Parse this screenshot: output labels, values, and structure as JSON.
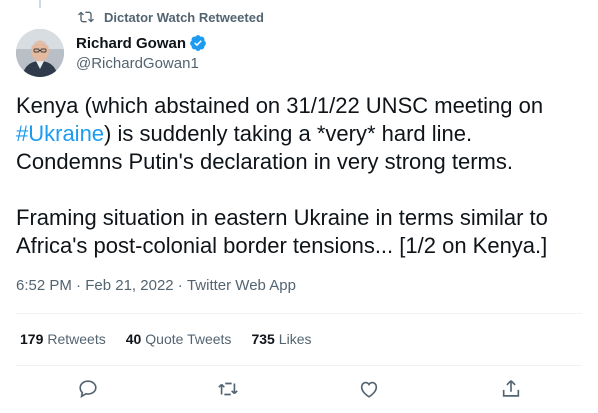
{
  "retweet_banner": {
    "text": "Dictator Watch Retweeted",
    "icon": "retweet-icon"
  },
  "author": {
    "display_name": "Richard Gowan",
    "handle": "@RichardGowan1",
    "verified": true,
    "verified_color": "#1d9bf0"
  },
  "tweet": {
    "line1": "Kenya (which abstained on 31/1/22 UNSC meeting on",
    "hashtag": "#Ukraine",
    "line2_rest": ") is suddenly taking a *very* hard line.",
    "line3": "Condemns Putin's declaration in very strong terms.",
    "line4": "Framing situation in eastern Ukraine in terms similar to",
    "line5": "Africa's post-colonial border tensions... [1/2 on Kenya.]"
  },
  "meta": {
    "time": "6:52 PM",
    "separator": " · ",
    "date": "Feb 21, 2022",
    "source": "Twitter Web App"
  },
  "stats": {
    "retweets_count": "179",
    "retweets_label": "Retweets",
    "quotes_count": "40",
    "quotes_label": "Quote Tweets",
    "likes_count": "735",
    "likes_label": "Likes"
  },
  "actions": [
    "reply-icon",
    "retweet-icon",
    "like-icon",
    "share-icon"
  ],
  "colors": {
    "accent": "#1d9bf0",
    "text": "#0f1419",
    "muted": "#536471",
    "divider": "#eff3f4"
  }
}
